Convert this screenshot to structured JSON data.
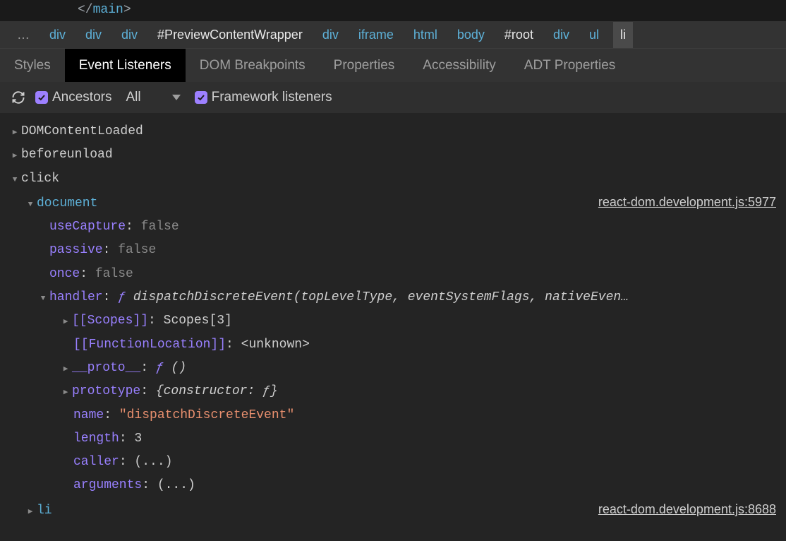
{
  "source_line": {
    "closing_tag": "main"
  },
  "breadcrumbs": {
    "ellipsis": "…",
    "items": [
      "div",
      "div",
      "div",
      "#PreviewContentWrapper",
      "div",
      "iframe",
      "html",
      "body",
      "#root",
      "div",
      "ul"
    ],
    "selected": "li"
  },
  "tabs": {
    "items": [
      "Styles",
      "Event Listeners",
      "DOM Breakpoints",
      "Properties",
      "Accessibility",
      "ADT Properties"
    ],
    "active_index": 1
  },
  "toolbar": {
    "ancestors_label": "Ancestors",
    "filter_label": "All",
    "framework_label": "Framework listeners"
  },
  "events": {
    "e0": {
      "name": "DOMContentLoaded"
    },
    "e1": {
      "name": "beforeunload"
    },
    "e2": {
      "name": "click",
      "target": "document",
      "source_link": "react-dom.development.js:5977",
      "props": {
        "useCapture": {
          "key": "useCapture",
          "value": "false"
        },
        "passive": {
          "key": "passive",
          "value": "false"
        },
        "once": {
          "key": "once",
          "value": "false"
        }
      },
      "handler": {
        "key": "handler",
        "f": "ƒ",
        "sig": "dispatchDiscreteEvent(topLevelType, eventSystemFlags, nativeEven…",
        "scopes": {
          "key": "[[Scopes]]",
          "value": "Scopes[3]"
        },
        "funloc": {
          "key": "[[FunctionLocation]]",
          "value": "<unknown>"
        },
        "proto": {
          "key": "__proto__",
          "f": "ƒ",
          "value": "()"
        },
        "prototype": {
          "key": "prototype",
          "value": "{constructor: ƒ}"
        },
        "name": {
          "key": "name",
          "value": "\"dispatchDiscreteEvent\""
        },
        "length": {
          "key": "length",
          "value": "3"
        },
        "caller": {
          "key": "caller",
          "value": "(...)"
        },
        "arguments": {
          "key": "arguments",
          "value": "(...)"
        }
      }
    },
    "e3": {
      "name": "li",
      "source_link": "react-dom.development.js:8688"
    }
  }
}
